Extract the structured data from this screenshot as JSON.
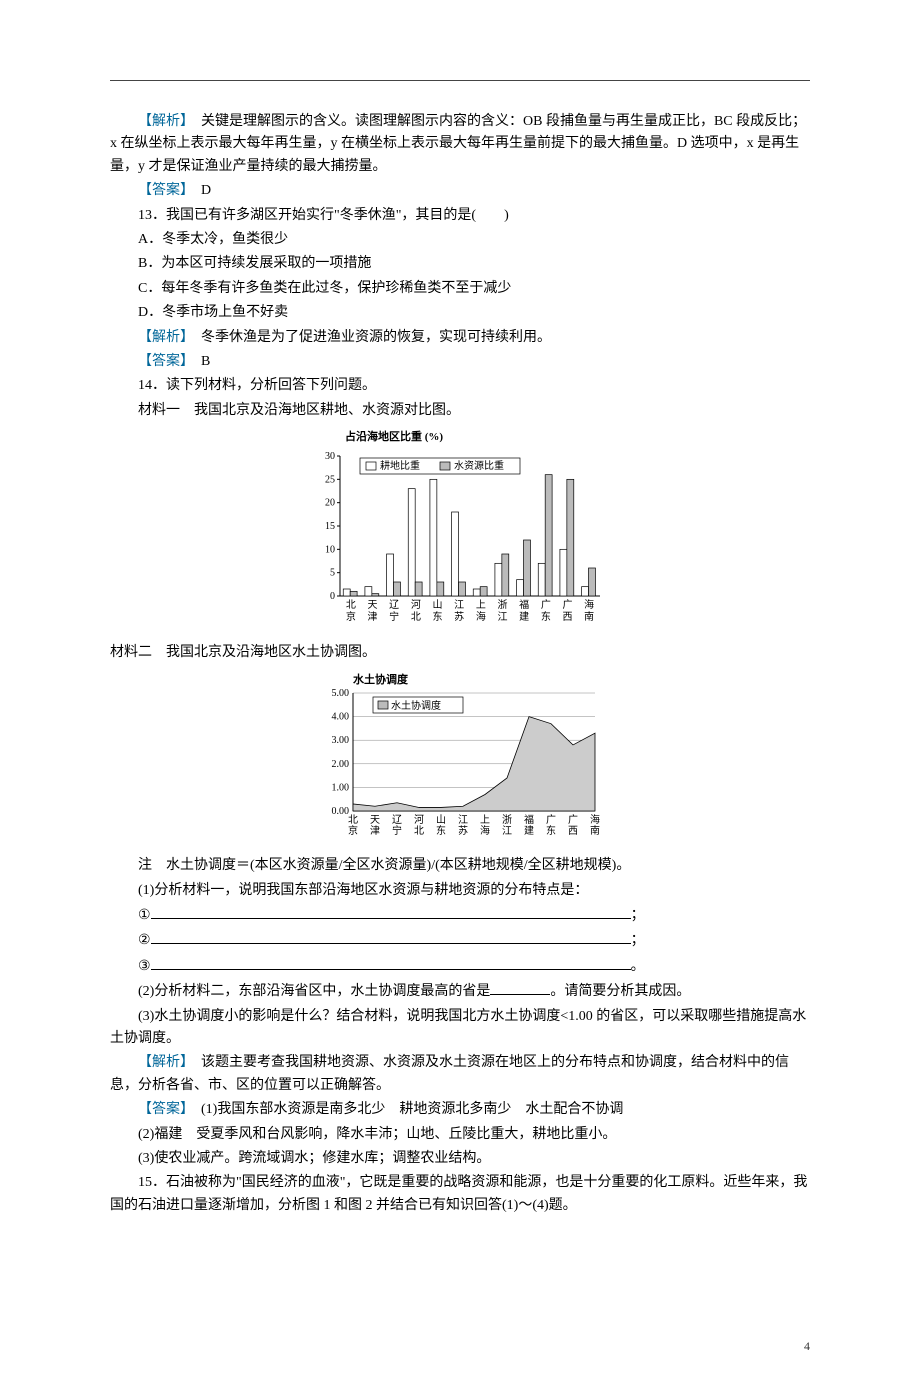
{
  "para_analysis12": {
    "label": "【解析】",
    "text": "　关键是理解图示的含义。读图理解图示内容的含义：OB 段捕鱼量与再生量成正比，BC 段成反比；x 在纵坐标上表示最大每年再生量，y 在横坐标上表示最大每年再生量前提下的最大捕鱼量。D 选项中，x 是再生量，y 才是保证渔业产量持续的最大捕捞量。"
  },
  "ans12": {
    "label": "【答案】",
    "value": "　D"
  },
  "q13": {
    "stem": "13．我国已有许多湖区开始实行\"冬季休渔\"，其目的是(　　)",
    "A": "A．冬季太冷，鱼类很少",
    "B": "B．为本区可持续发展采取的一项措施",
    "C": "C．每年冬季有许多鱼类在此过冬，保护珍稀鱼类不至于减少",
    "D": "D．冬季市场上鱼不好卖",
    "analysis_label": "【解析】",
    "analysis_text": "　冬季休渔是为了促进渔业资源的恢复，实现可持续利用。",
    "answer_label": "【答案】",
    "answer_value": "　B"
  },
  "q14": {
    "stem": "14．读下列材料，分析回答下列问题。",
    "mat1": "材料一　我国北京及沿海地区耕地、水资源对比图。",
    "mat2": "材料二　我国北京及沿海地区水土协调图。",
    "note": "注　水土协调度＝(本区水资源量/全区水资源量)/(本区耕地规模/全区耕地规模)。",
    "sub1": "(1)分析材料一，说明我国东部沿海地区水资源与耕地资源的分布特点是：",
    "circ1": "①",
    "circ2": "②",
    "circ3": "③",
    "sub2_a": "(2)分析材料二，东部沿海省区中，水土协调度最高的省是",
    "sub2_b": "。请简要分析其成因。",
    "sub3": "(3)水土协调度小的影响是什么？结合材料，说明我国北方水土协调度<1.00 的省区，可以采取哪些措施提高水土协调度。",
    "analysis_label": "【解析】",
    "analysis_text": "　该题主要考查我国耕地资源、水资源及水土资源在地区上的分布特点和协调度，结合材料中的信息，分析各省、市、区的位置可以正确解答。",
    "answer_label": "【答案】",
    "answer_text1": "　(1)我国东部水资源是南多北少　耕地资源北多南少　水土配合不协调",
    "answer_text2": "(2)福建　受夏季风和台风影响，降水丰沛；山地、丘陵比重大，耕地比重小。",
    "answer_text3": "(3)使农业减产。跨流域调水；修建水库；调整农业结构。"
  },
  "q15": {
    "text": "15．石油被称为\"国民经济的血液\"，它既是重要的战略资源和能源，也是十分重要的化工原料。近些年来，我国的石油进口量逐渐增加，分析图 1 和图 2 并结合已有知识回答(1)～(4)题。"
  },
  "footer": {
    "page": "4"
  },
  "chart_data": [
    {
      "type": "bar",
      "title": "占沿海地区比重 (%)",
      "categories": [
        "北京",
        "天津",
        "辽宁",
        "河北",
        "山东",
        "江苏",
        "上海",
        "浙江",
        "福建",
        "广东",
        "广西",
        "海南"
      ],
      "series": [
        {
          "name": "耕地比重",
          "values": [
            1.5,
            2,
            9,
            23,
            25,
            18,
            1.5,
            7,
            3.5,
            7,
            10,
            2
          ]
        },
        {
          "name": "水资源比重",
          "values": [
            1,
            0.5,
            3,
            3,
            3,
            3,
            2,
            9,
            12,
            26,
            25,
            6
          ]
        }
      ],
      "ylabel": "",
      "xlabel": "",
      "ylim": [
        0,
        30
      ],
      "yticks": [
        0,
        5,
        10,
        15,
        20,
        25,
        30
      ],
      "legend_pos": "top-inside"
    },
    {
      "type": "area",
      "title": "水土协调度",
      "categories": [
        "北京",
        "天津",
        "辽宁",
        "河北",
        "山东",
        "江苏",
        "上海",
        "浙江",
        "福建",
        "广东",
        "广西",
        "海南"
      ],
      "series": [
        {
          "name": "水土协调度",
          "values": [
            0.3,
            0.2,
            0.35,
            0.15,
            0.15,
            0.2,
            0.7,
            1.4,
            4.0,
            3.7,
            2.8,
            3.3
          ]
        }
      ],
      "ylim": [
        0,
        5
      ],
      "yticks": [
        0.0,
        1.0,
        2.0,
        3.0,
        4.0,
        5.0
      ],
      "legend_pos": "top-inside"
    }
  ]
}
